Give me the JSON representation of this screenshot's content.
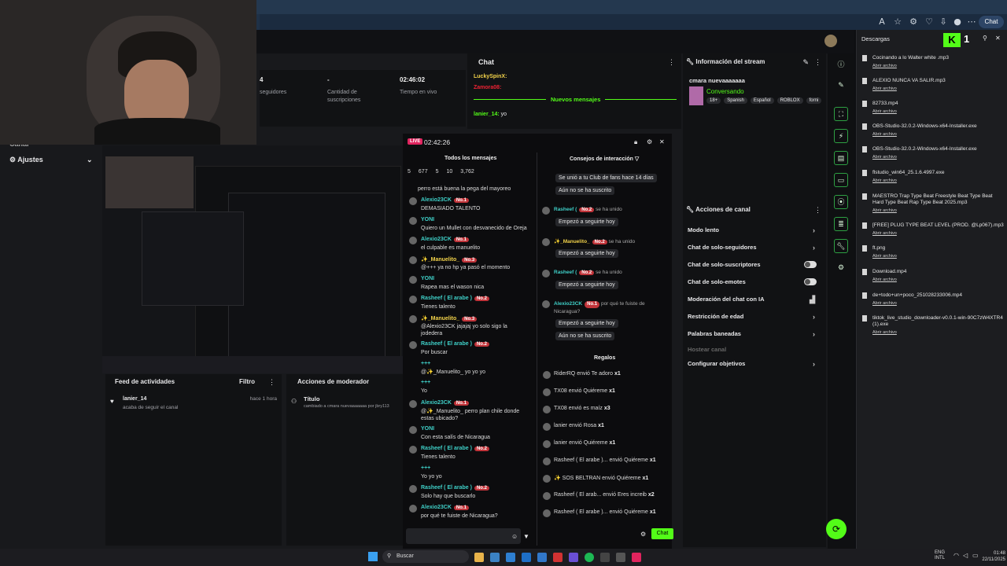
{
  "browser": {
    "chat_button": "Chat"
  },
  "leftnav": {
    "items": [
      {
        "label": "Canal"
      },
      {
        "label": "Ajustes"
      }
    ]
  },
  "stats": [
    {
      "value": "4",
      "label": "seguidores"
    },
    {
      "value": "-",
      "label": "Cantidad de suscripciones"
    },
    {
      "value": "02:46:02",
      "label": "Tiempo en vivo"
    }
  ],
  "chat": {
    "title": "Chat",
    "users": [
      {
        "name": "LuckySpinX:"
      },
      {
        "name": "Zamora08:"
      }
    ],
    "divider": "Nuevos mensajes",
    "last": {
      "user": "lanier_14:",
      "text": "yo"
    }
  },
  "info": {
    "title": "Información del stream",
    "stream_title": "cmara nuevaaaaaaa",
    "category": "Conversando",
    "tags": [
      "18+",
      "Spanish",
      "Español",
      "ROBLOX",
      "forni"
    ]
  },
  "actions": {
    "title": "Acciones de canal",
    "items": [
      {
        "label": "Modo lento",
        "control": "arrow"
      },
      {
        "label": "Chat de solo-seguidores",
        "control": "arrow"
      },
      {
        "label": "Chat de solo-suscriptores",
        "control": "toggle"
      },
      {
        "label": "Chat de solo-emotes",
        "control": "toggle"
      },
      {
        "label": "Moderación del chat con IA",
        "control": "icon"
      },
      {
        "label": "Restricción de edad",
        "control": "arrow"
      },
      {
        "label": "Palabras baneadas",
        "control": "arrow"
      },
      {
        "label": "Hostear canal",
        "control": "none"
      },
      {
        "label": "Configurar objetivos",
        "control": "arrow"
      }
    ]
  },
  "feed": {
    "title": "Feed de actividades",
    "filter": "Filtro",
    "user": "lanier_14",
    "event": "acaba de seguir el canal",
    "time": "hace 1 hora"
  },
  "modactions": {
    "title": "Acciones de moderador",
    "item_title": "Título",
    "item_text": "cambiado a cmara nuevaaaaaaa por jbry113"
  },
  "overlay": {
    "live": "LIVE",
    "time": "02:42:26",
    "all_messages": "Todos los mensajes",
    "tips": "Consejos de interacción",
    "counters": [
      "5",
      "677",
      "5",
      "10",
      "3,762"
    ],
    "messages": [
      {
        "user": "",
        "text": "perro está buena la pega del mayoreo"
      },
      {
        "user": "Alexio23CK",
        "badge": "No.1",
        "text": "DEMASIADO TALENTO"
      },
      {
        "user": "YONI",
        "text": "Quiero un Mullet con desvanecido de Oreja"
      },
      {
        "user": "Alexio23CK",
        "badge": "No.1",
        "text": "el culpable es manuelito"
      },
      {
        "user": "✨_Manuelito_",
        "badge": "No.3",
        "text": "@+++ ya no hp ya pasó el momento"
      },
      {
        "user": "YONI",
        "text": "Rapea mas el wason nica"
      },
      {
        "user": "Rasheef ( El arabe )",
        "badge": "No.2",
        "text": "Tienes talento"
      },
      {
        "user": "✨_Manuelito_",
        "badge": "No.3",
        "text": "@Alexio23CK jajajaj yo solo sigo la jodedera"
      },
      {
        "user": "Rasheef ( El arabe )",
        "badge": "No.2",
        "text": "Por buscar"
      },
      {
        "user": "+++",
        "text": "@✨_Manuelito_ yo yo yo"
      },
      {
        "user": "+++",
        "text": "Yo"
      },
      {
        "user": "Alexio23CK",
        "badge": "No.1",
        "text": "@✨_Manuelito_ perro plan chile donde estas ubicado?"
      },
      {
        "user": "YONI",
        "text": "Con esta salís de Nicaragua"
      },
      {
        "user": "Rasheef ( El arabe )",
        "badge": "No.2",
        "text": "Tienes talento"
      },
      {
        "user": "+++",
        "text": "Yo yo yo"
      },
      {
        "user": "Rasheef ( El arabe )",
        "badge": "No.2",
        "text": "Solo hay que buscarlo"
      },
      {
        "user": "Alexio23CK",
        "badge": "No.1",
        "text": "por qué te fuiste de Nicaragua?"
      }
    ],
    "interactions": [
      {
        "text": "Se unió a tu Club de fans hace 14 días"
      },
      {
        "text": "Aún no se ha suscrito"
      },
      {
        "user": "Rasheef (",
        "badge": "No.2",
        "note": "se ha unido",
        "text": "Empezó a seguirte hoy"
      },
      {
        "user": "✨_Manuelito_",
        "badge": "No.2",
        "note": "se ha unido",
        "text": "Empezó a seguirte hoy"
      },
      {
        "user": "Rasheef (",
        "badge": "No.2",
        "note": "se ha unido",
        "text": "Empezó a seguirte hoy"
      },
      {
        "user": "Alexio23CK",
        "badge": "No.1",
        "note": "por qué te fuiste de Nicaragua?",
        "text": "Empezó a seguirte hoy"
      },
      {
        "text": "Aún no se ha suscrito"
      }
    ],
    "gifts_title": "Regalos",
    "gifts": [
      {
        "user": "RiderRQ",
        "verb": "envió",
        "item": "Te adoro",
        "count": "x1"
      },
      {
        "user": "TX08",
        "verb": "envió",
        "item": "Quiéreme",
        "count": "x1"
      },
      {
        "user": "TX08",
        "verb": "envió es",
        "item": "maíz",
        "count": "x3"
      },
      {
        "user": "lanier",
        "verb": "envió",
        "item": "Rosa",
        "count": "x1"
      },
      {
        "user": "lanier",
        "verb": "envió",
        "item": "Quiéreme",
        "count": "x1"
      },
      {
        "user": "Rasheef ( El arabe )...",
        "verb": "envió",
        "item": "Quiéreme",
        "count": "x1"
      },
      {
        "user": "✨ SOS BELTRAN",
        "verb": "envió",
        "item": "Quiéreme",
        "count": "x1"
      },
      {
        "user": "Rasheef ( El arab...",
        "verb": "envió",
        "item": "Eres increib",
        "count": "x2"
      },
      {
        "user": "Rasheef ( El arabe )...",
        "verb": "envió",
        "item": "Quiéreme",
        "count": "x1"
      }
    ],
    "send": "Chat"
  },
  "downloads": {
    "title": "Descargas",
    "open_label": "Abrir archivo",
    "files": [
      "Cocinando a lo Walter white .mp3",
      "ALEXIO NUNCA VA SALIR.mp3",
      "82733.mp4",
      "OBS-Studio-32.0.2-Windows-x64-Installer.exe",
      "OBS-Studio-32.0.2-Windows-x64-Installer.exe",
      "flstudio_win64_25.1.6.4997.exe",
      "MAESTRO Trap Type Beat Freestyle Beat Type Beat Hard Type Beat Rap Type Beat 2025.mp3",
      "[FREE] PLUG TYPE BEAT LEVEL (PROD. @Lp067).mp3",
      "ft.png",
      "Download.mp4",
      "de+todo+un+poco_251028233006.mp4",
      "tiktok_live_studio_downloader-v0.0.1-win-90C7zW4XTR4 (1).exe"
    ]
  },
  "taskbar": {
    "search": "Buscar",
    "lang": "ENG",
    "lang2": "INTL",
    "time": "01:48",
    "date": "22/11/2025"
  },
  "colors": {
    "accent": "#53fc18",
    "live": "#e0245e",
    "badge": "#c1343a"
  }
}
